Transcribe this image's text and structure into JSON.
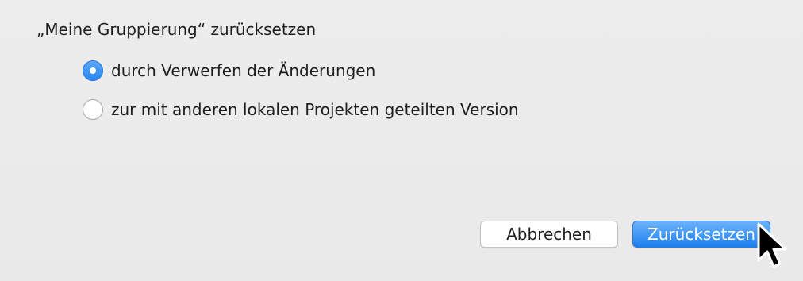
{
  "dialog": {
    "title": "„Meine Gruppierung“ zurücksetzen",
    "options": [
      {
        "label": "durch Verwerfen der Änderungen",
        "selected": true
      },
      {
        "label": "zur mit anderen lokalen Projekten geteilten Version",
        "selected": false
      }
    ],
    "buttons": {
      "cancel_label": "Abbrechen",
      "confirm_label": "Zurücksetzen"
    }
  },
  "colors": {
    "accent": "#2a86f1",
    "background": "#ececec"
  },
  "icons": {
    "cursor": "mouse-pointer-icon"
  }
}
